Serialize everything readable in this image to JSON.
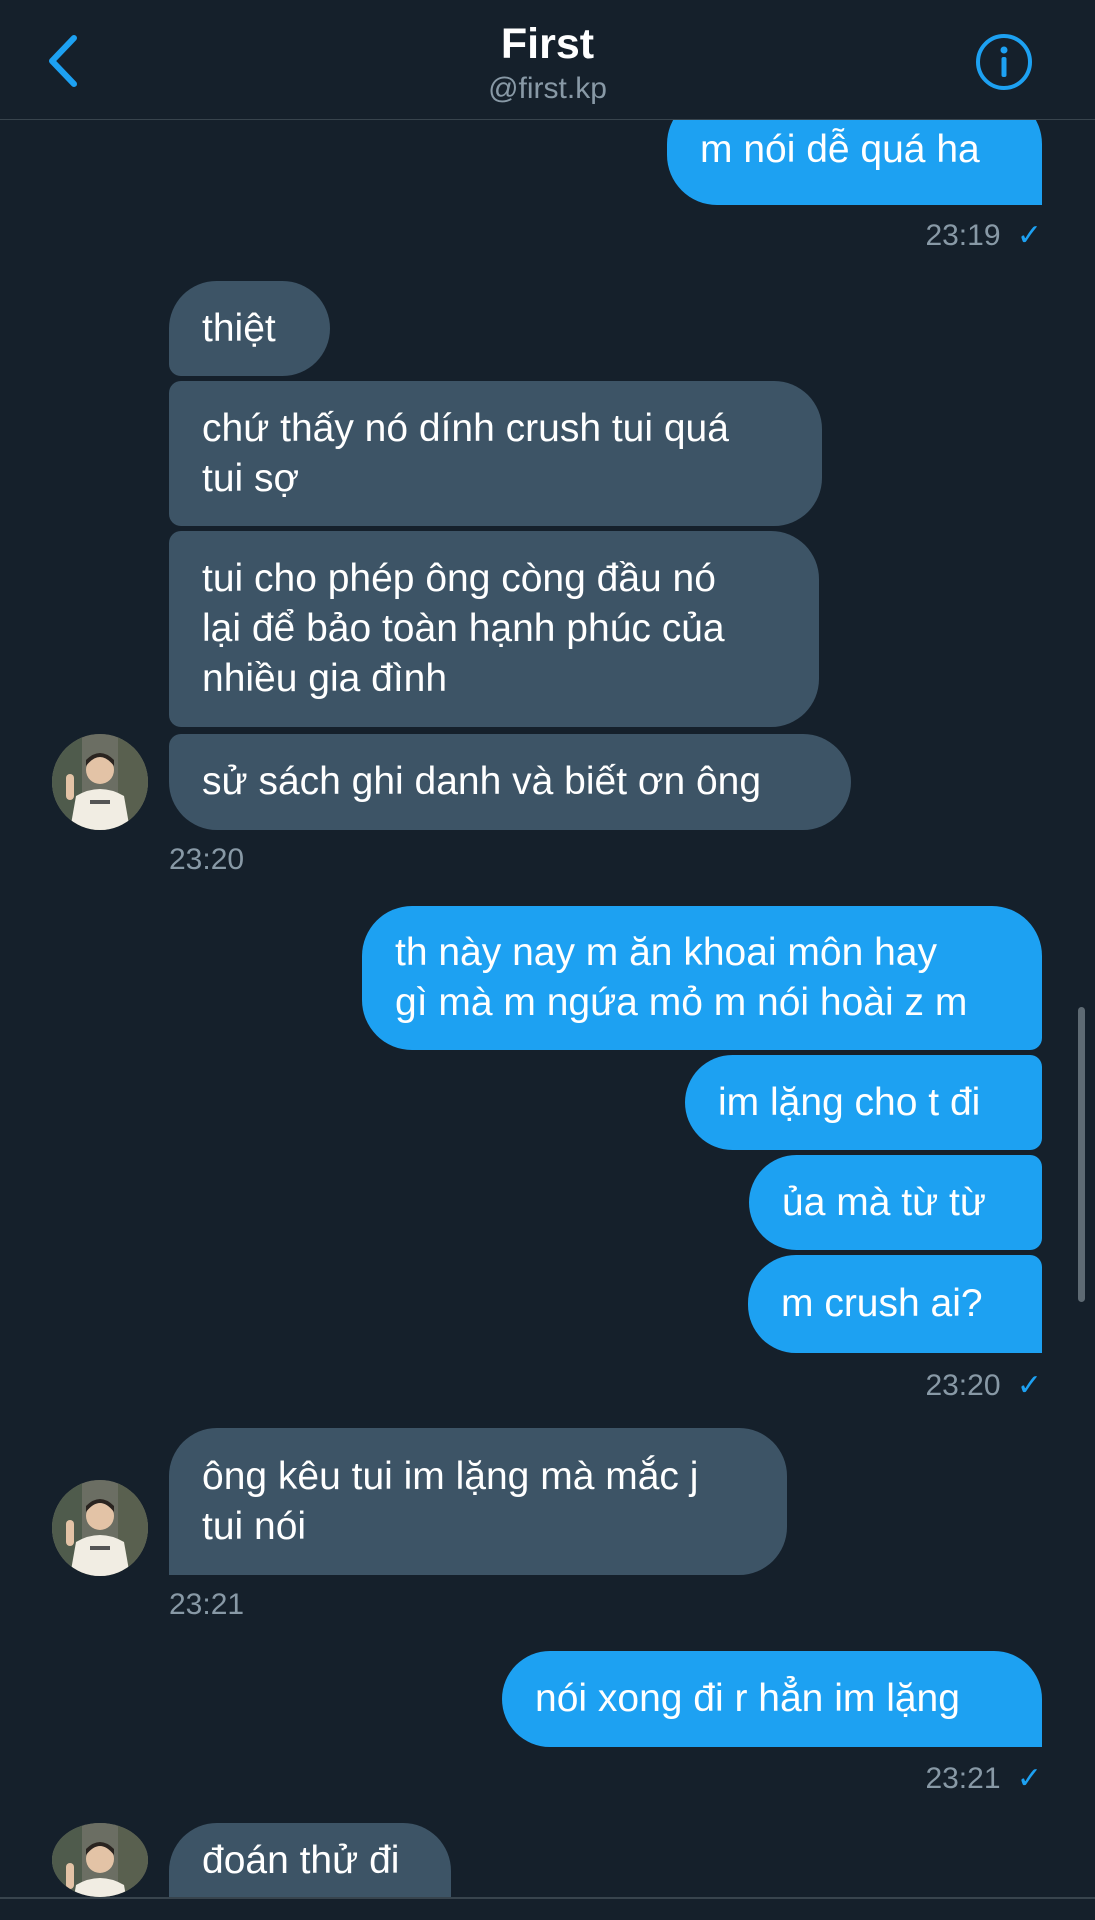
{
  "header": {
    "title": "First",
    "handle": "@first.kp"
  },
  "messages": [
    {
      "dir": "out",
      "lines": [
        "m nói dễ quá ha"
      ]
    },
    {
      "time": "23:19",
      "dir": "out",
      "read": true
    },
    {
      "dir": "in",
      "lines": [
        "thiệt"
      ]
    },
    {
      "dir": "in",
      "lines": [
        "chứ thấy nó dính crush tui quá",
        "tui sợ"
      ]
    },
    {
      "dir": "in",
      "lines": [
        "tui cho phép ông còng đầu nó",
        "lại để bảo toàn hạnh phúc của",
        "nhiều gia đình"
      ]
    },
    {
      "dir": "in",
      "lines": [
        "sử sách ghi danh và biết ơn ông"
      ]
    },
    {
      "time": "23:20",
      "dir": "in"
    },
    {
      "dir": "out",
      "lines": [
        "th này nay m ăn khoai môn hay",
        "gì mà m ngứa mỏ m nói hoài z m"
      ]
    },
    {
      "dir": "out",
      "lines": [
        "im lặng cho t đi"
      ]
    },
    {
      "dir": "out",
      "lines": [
        "ủa mà từ từ"
      ]
    },
    {
      "dir": "out",
      "lines": [
        "m crush ai?"
      ]
    },
    {
      "time": "23:20",
      "dir": "out",
      "read": true
    },
    {
      "dir": "in",
      "lines": [
        "ông kêu tui im lặng mà mắc j",
        "tui nói"
      ]
    },
    {
      "time": "23:21",
      "dir": "in"
    },
    {
      "dir": "out",
      "lines": [
        "nói xong đi r hẳn im lặng"
      ]
    },
    {
      "time": "23:21",
      "dir": "out",
      "read": true
    },
    {
      "dir": "in",
      "lines": [
        "đoán thử đi"
      ]
    }
  ],
  "icons": {
    "back": "chevron-left-icon",
    "info": "info-circle-icon",
    "read": "checkmark-icon"
  },
  "colors": {
    "background": "#15202b",
    "outgoing_bubble": "#1da1f2",
    "incoming_bubble": "#3d5466",
    "accent": "#1da1f2",
    "muted_text": "#8899a6"
  }
}
